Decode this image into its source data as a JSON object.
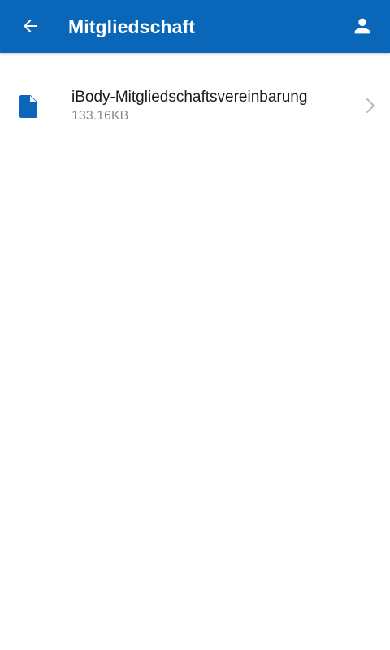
{
  "header": {
    "title": "Mitgliedschaft",
    "back_icon": "arrow-left-icon",
    "profile_icon": "person-icon"
  },
  "documents": [
    {
      "name": "iBody-Mitgliedschaftsvereinbarung",
      "size": "133.16KB",
      "icon": "document-icon"
    }
  ],
  "colors": {
    "primary": "#0a66b8",
    "text_primary": "#1a1a1a",
    "text_secondary": "#8a8a8a",
    "divider": "#d6d6d6",
    "chevron": "#b8b8b8"
  }
}
